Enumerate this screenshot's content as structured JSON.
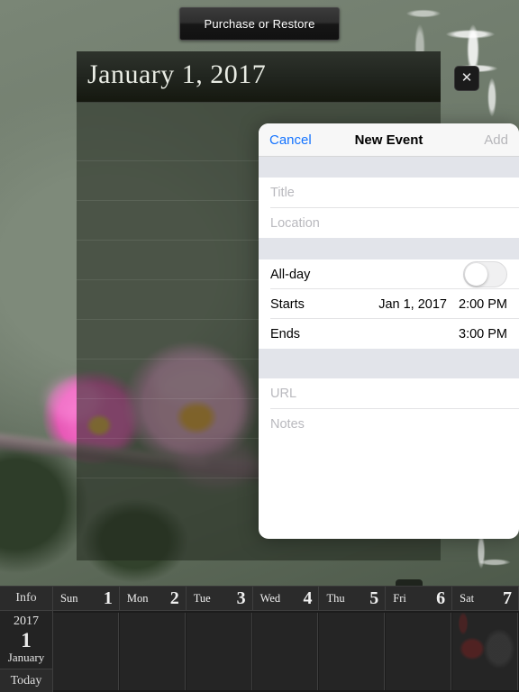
{
  "purchase_button": {
    "label": "Purchase or Restore"
  },
  "day_panel": {
    "date_title": "January 1, 2017",
    "close_icon": "close-x-icon",
    "scroll_down_icon": "chevron-down-icon"
  },
  "new_event_modal": {
    "cancel_label": "Cancel",
    "title": "New Event",
    "add_label": "Add",
    "fields": {
      "title_placeholder": "Title",
      "location_placeholder": "Location",
      "allday_label": "All-day",
      "allday_on": false,
      "starts_label": "Starts",
      "starts_date": "Jan 1, 2017",
      "starts_time": "2:00 PM",
      "ends_label": "Ends",
      "ends_date": "",
      "ends_time": "3:00 PM",
      "url_placeholder": "URL",
      "notes_placeholder": "Notes"
    },
    "accent_color": "#1473ff",
    "disabled_color": "#b6b6ba"
  },
  "calendar_strip": {
    "info_label": "Info",
    "today_label": "Today",
    "info_year": "2017",
    "info_day": "1",
    "info_month": "January",
    "days": [
      {
        "dow": "Sun",
        "num": "1"
      },
      {
        "dow": "Mon",
        "num": "2"
      },
      {
        "dow": "Tue",
        "num": "3"
      },
      {
        "dow": "Wed",
        "num": "4"
      },
      {
        "dow": "Thu",
        "num": "5"
      },
      {
        "dow": "Fri",
        "num": "6"
      },
      {
        "dow": "Sat",
        "num": "7"
      }
    ]
  },
  "background": {
    "description": "pink camellia flowers photo with white calligraphy",
    "base_color": "#6e7a6b",
    "flower_color": "#e557b4"
  }
}
